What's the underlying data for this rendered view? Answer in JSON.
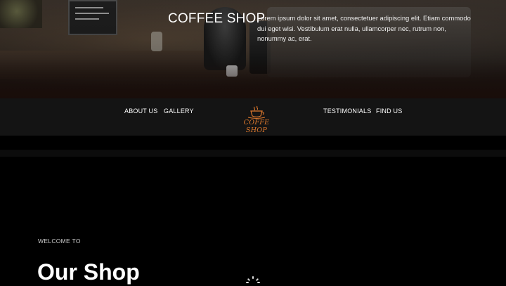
{
  "hero": {
    "title": "COFFEE SHOP",
    "description": "Lorem ipsum dolor sit amet, consectetuer adipiscing elit. Etiam commodo dui eget wisi. Vestibulum erat nulla, ullamcorper nec, rutrum non, nonummy ac, erat."
  },
  "nav": {
    "items": [
      {
        "label": "ABOUT US"
      },
      {
        "label": "GALLERY"
      },
      {
        "label": "TESTIMONIALS"
      },
      {
        "label": "FIND US"
      }
    ],
    "logo_text": "COFFE SHOP",
    "logo_icon": "coffee-cup-icon"
  },
  "main": {
    "welcome": "WELCOME TO",
    "heading": "Our Shop"
  },
  "colors": {
    "accent": "#e07a2e",
    "nav_bg": "#141414",
    "page_bg": "#000000"
  }
}
